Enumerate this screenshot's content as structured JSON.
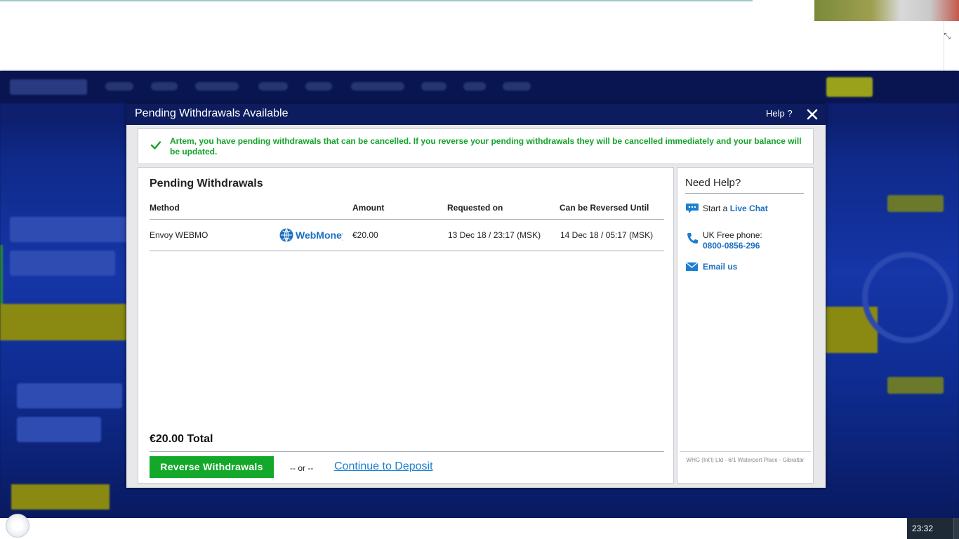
{
  "modal": {
    "title": "Pending Withdrawals Available",
    "help_label": "Help ?",
    "close_icon": "close-icon"
  },
  "alert": {
    "icon": "checkmark-icon",
    "message": "Artem, you have pending withdrawals that can be cancelled. If you reverse your pending withdrawals they will be cancelled immediately and your balance will be updated."
  },
  "withdrawals": {
    "heading": "Pending Withdrawals",
    "columns": [
      "Method",
      "Amount",
      "Requested on",
      "Can be Reversed Until"
    ],
    "rows": [
      {
        "method": "Envoy WEBMO",
        "logo": "WebMoney",
        "amount": "€20.00",
        "requested_on": "13 Dec 18 / 23:17 (MSK)",
        "reversible_until": "14 Dec 18 / 05:17 (MSK)"
      }
    ],
    "total": "€20.00 Total",
    "reverse_button": "Reverse Withdrawals",
    "or_text": "-- or --",
    "continue_link": "Continue to Deposit"
  },
  "help_panel": {
    "heading": "Need Help?",
    "chat_prefix": "Start a ",
    "chat_link": "Live Chat",
    "phone_label": "UK Free phone:",
    "phone_number": "0800-0856-296",
    "email_link": "Email us",
    "legal": "WHG (Int'l) Ltd - 6/1 Waterport Place - Gibraltar"
  },
  "taskbar": {
    "clock": "23:32"
  },
  "colors": {
    "header_navy": "#0c1c5e",
    "success_green": "#13a32a",
    "button_green": "#13a82a",
    "link_blue": "#1a7fd0"
  }
}
